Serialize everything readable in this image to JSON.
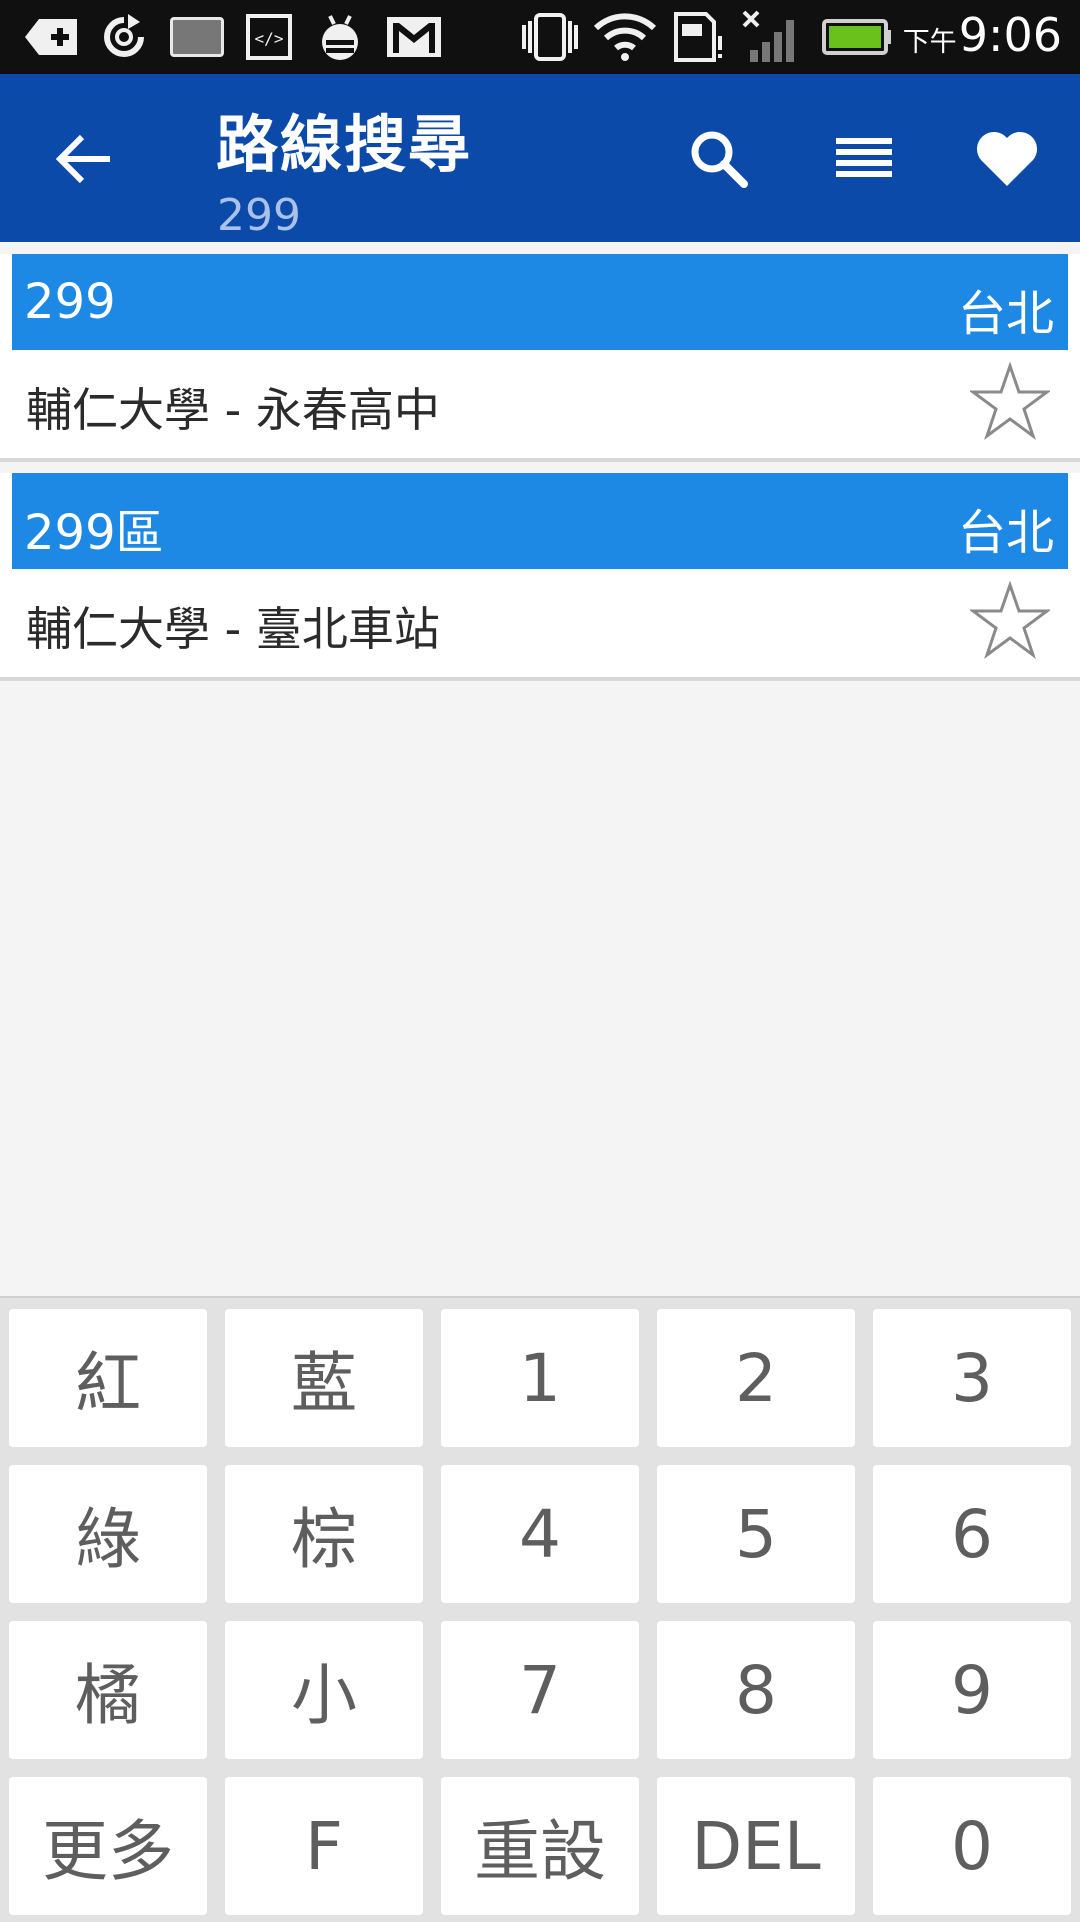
{
  "status_bar": {
    "ampm": "下午",
    "time": "9:06",
    "icons": [
      "add-icon",
      "sync-icon",
      "image-icon",
      "code-icon",
      "bug-icon",
      "gmail-icon",
      "vibrate-icon",
      "wifi-icon",
      "sim-icon",
      "no-signal-icon",
      "battery-icon"
    ]
  },
  "app_bar": {
    "title": "路線搜尋",
    "subtitle": "299",
    "icons": [
      "back-arrow-icon",
      "search-icon",
      "list-icon",
      "heart-icon"
    ]
  },
  "results": [
    {
      "route": "299",
      "city": "台北",
      "description": "輔仁大學 - 永春高中"
    },
    {
      "route": "299區",
      "city": "台北",
      "description": "輔仁大學 - 臺北車站"
    }
  ],
  "keypad": {
    "keys": [
      "紅",
      "藍",
      "1",
      "2",
      "3",
      "綠",
      "棕",
      "4",
      "5",
      "6",
      "橘",
      "小",
      "7",
      "8",
      "9",
      "更多",
      "F",
      "重設",
      "DEL",
      "0"
    ]
  },
  "colors": {
    "app_bar": "#0b4aa8",
    "route_header": "#1e88e5",
    "status_bar": "#101010",
    "keypad_bg": "#e2e2e2"
  }
}
